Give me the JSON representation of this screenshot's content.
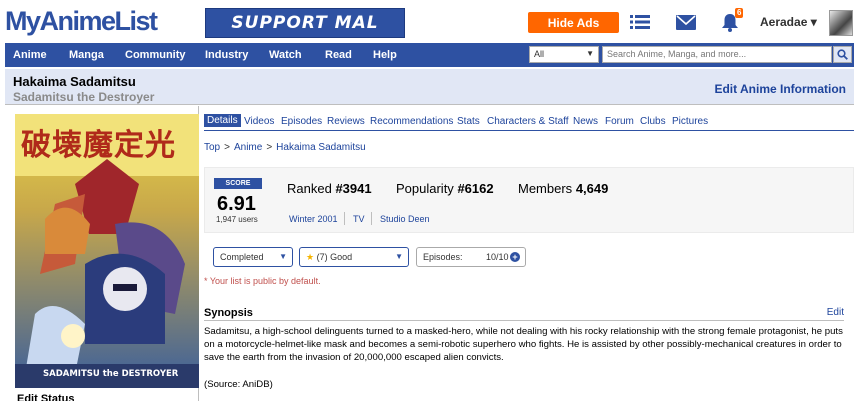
{
  "header": {
    "logo": "MyAnimeList",
    "banner": "SUPPORT MAL",
    "hide_ads": "Hide Ads",
    "notification_count": "6",
    "username": "Aeradae ▾"
  },
  "nav": {
    "items": [
      "Anime",
      "Manga",
      "Community",
      "Industry",
      "Watch",
      "Read",
      "Help"
    ],
    "search_category": "All",
    "search_placeholder": "Search Anime, Manga, and more..."
  },
  "title": {
    "main": "Hakaima Sadamitsu",
    "english": "Sadamitsu the Destroyer",
    "edit_link": "Edit Anime Information"
  },
  "left": {
    "poster_text": "破壊魔定光",
    "poster_sub": "SADAMITSU the DESTROYER",
    "edit_status": "Edit Status"
  },
  "tabs": [
    "Details",
    "Videos",
    "Episodes",
    "Reviews",
    "Recommendations",
    "Stats",
    "Characters & Staff",
    "News",
    "Forum",
    "Clubs",
    "Pictures"
  ],
  "breadcrumb": [
    "Top",
    "Anime",
    "Hakaima Sadamitsu"
  ],
  "stats": {
    "score_label": "SCORE",
    "score": "6.91",
    "score_users": "1,947 users",
    "ranked_label": "Ranked",
    "ranked": "#3941",
    "popularity_label": "Popularity",
    "popularity": "#6162",
    "members_label": "Members",
    "members": "4,649",
    "season": "Winter 2001",
    "type": "TV",
    "studio": "Studio Deen"
  },
  "controls": {
    "status": "Completed",
    "score": "(7) Good",
    "episodes_label": "Episodes:",
    "episodes_value": "10/10",
    "note": "* Your list is public by default."
  },
  "synopsis": {
    "title": "Synopsis",
    "edit": "Edit",
    "text": "Sadamitsu, a high-school delinguents turned to a masked-hero, while not dealing with his rocky relationship with the strong female protagonist, he puts on a motorcycle-helmet-like mask and becomes a semi-robotic superhero who fights. He is assisted by other possibly-mechanical creatures in order to save the earth from the invasion of 20,000,000 escaped alien convicts.",
    "source": "(Source: AniDB)"
  },
  "colors": {
    "brand_blue": "#2e51a2",
    "accent_orange": "#ff6600",
    "title_bg": "#e1e7f5"
  }
}
